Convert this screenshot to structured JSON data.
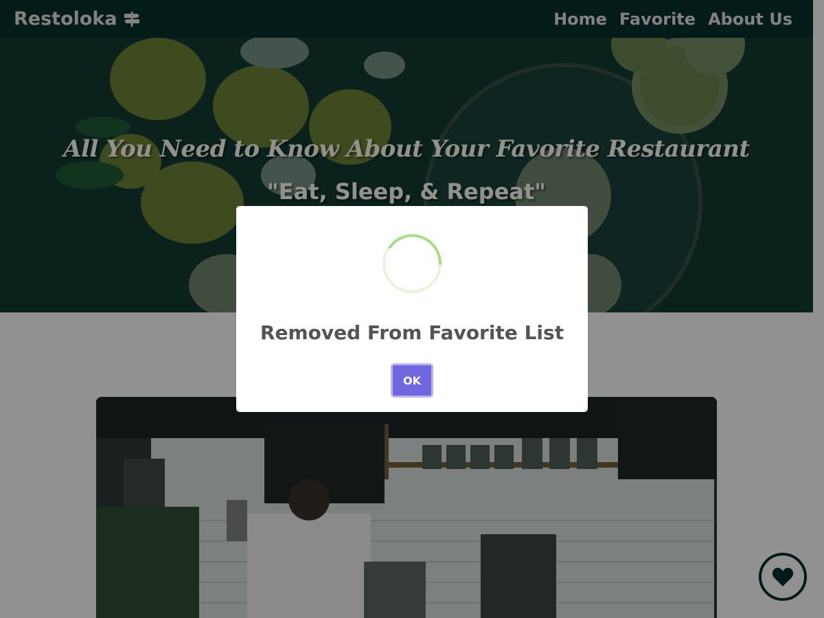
{
  "navbar": {
    "brand": "Restoloka",
    "links": [
      "Home",
      "Favorite",
      "About Us"
    ]
  },
  "hero": {
    "title": "All You Need to Know About Your Favorite Restaurant",
    "subtitle": "\"Eat, Sleep, & Repeat\""
  },
  "modal": {
    "title": "Removed From Favorite List",
    "confirm_label": "OK"
  },
  "icons": {
    "brand": "signpost-icon",
    "fav": "heart-icon",
    "status": "loading-spinner-icon"
  },
  "colors": {
    "navbar": "#07302a",
    "confirm_button": "#7066e0",
    "spinner": "#a5dc86"
  }
}
